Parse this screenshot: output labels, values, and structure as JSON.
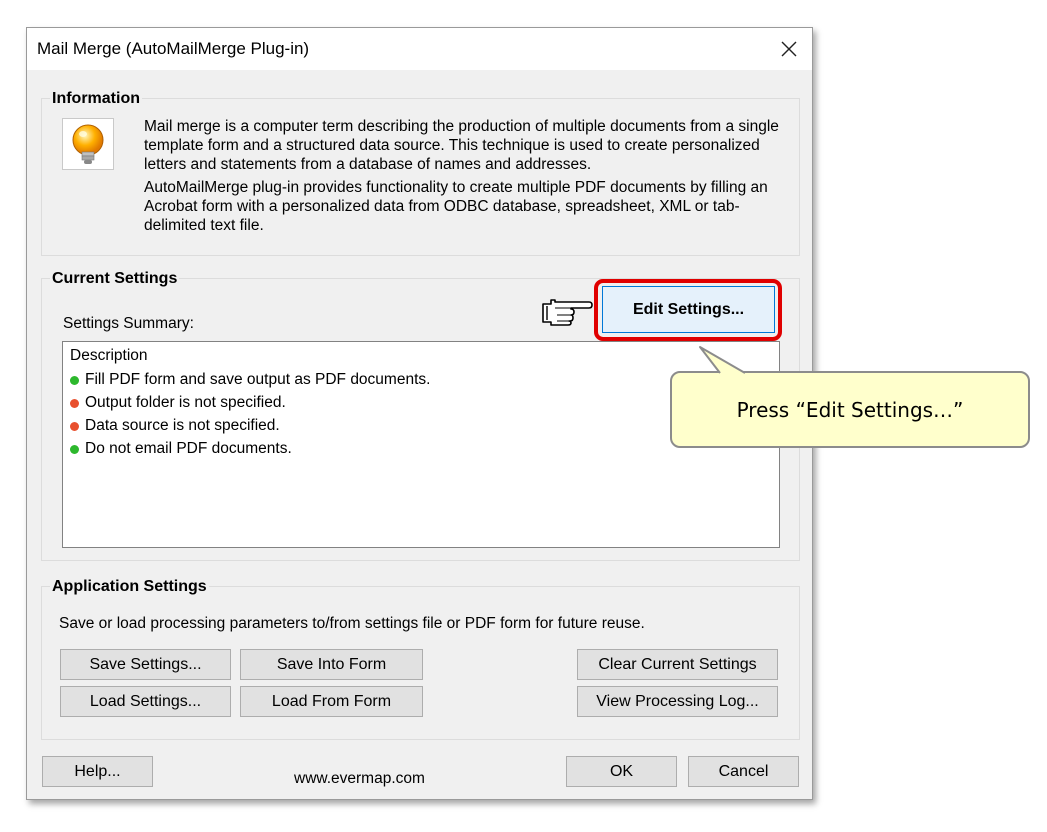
{
  "window": {
    "title": "Mail Merge (AutoMailMerge Plug-in)"
  },
  "information": {
    "heading": "Information",
    "paragraph1": "Mail merge is a computer term describing the production of multiple documents from a single template form and a structured data source. This technique is used to create personalized letters and statements from a database of names and addresses.",
    "paragraph2": "AutoMailMerge plug-in provides functionality to create multiple PDF documents by filling an Acrobat form with a personalized data from ODBC database, spreadsheet, XML or tab-delimited text file."
  },
  "current_settings": {
    "heading": "Current Settings",
    "summary_label": "Settings Summary:",
    "edit_button": "Edit Settings...",
    "summary": {
      "header": "Description",
      "items": [
        {
          "text": "Fill PDF form and save output as PDF documents.",
          "status": "ok"
        },
        {
          "text": "Output folder is not specified.",
          "status": "error"
        },
        {
          "text": "Data source is not specified.",
          "status": "error"
        },
        {
          "text": "Do not email PDF documents.",
          "status": "ok"
        }
      ]
    }
  },
  "application_settings": {
    "heading": "Application Settings",
    "description": "Save or load processing parameters to/from settings file or PDF form for future reuse.",
    "buttons": {
      "save_settings": "Save Settings...",
      "save_into_form": "Save Into Form",
      "clear_current": "Clear Current Settings",
      "load_settings": "Load Settings...",
      "load_from_form": "Load From Form",
      "view_log": "View Processing Log..."
    }
  },
  "footer": {
    "help": "Help...",
    "website": "www.evermap.com",
    "ok": "OK",
    "cancel": "Cancel"
  },
  "callout": {
    "text": "Press “Edit Settings…”"
  },
  "colors": {
    "status_ok": "#2db82d",
    "status_error": "#e8502e",
    "highlight": "#e00000",
    "callout_bg": "#ffffcc"
  },
  "icons": [
    "close-icon",
    "lightbulb-icon",
    "pointing-hand-icon"
  ]
}
